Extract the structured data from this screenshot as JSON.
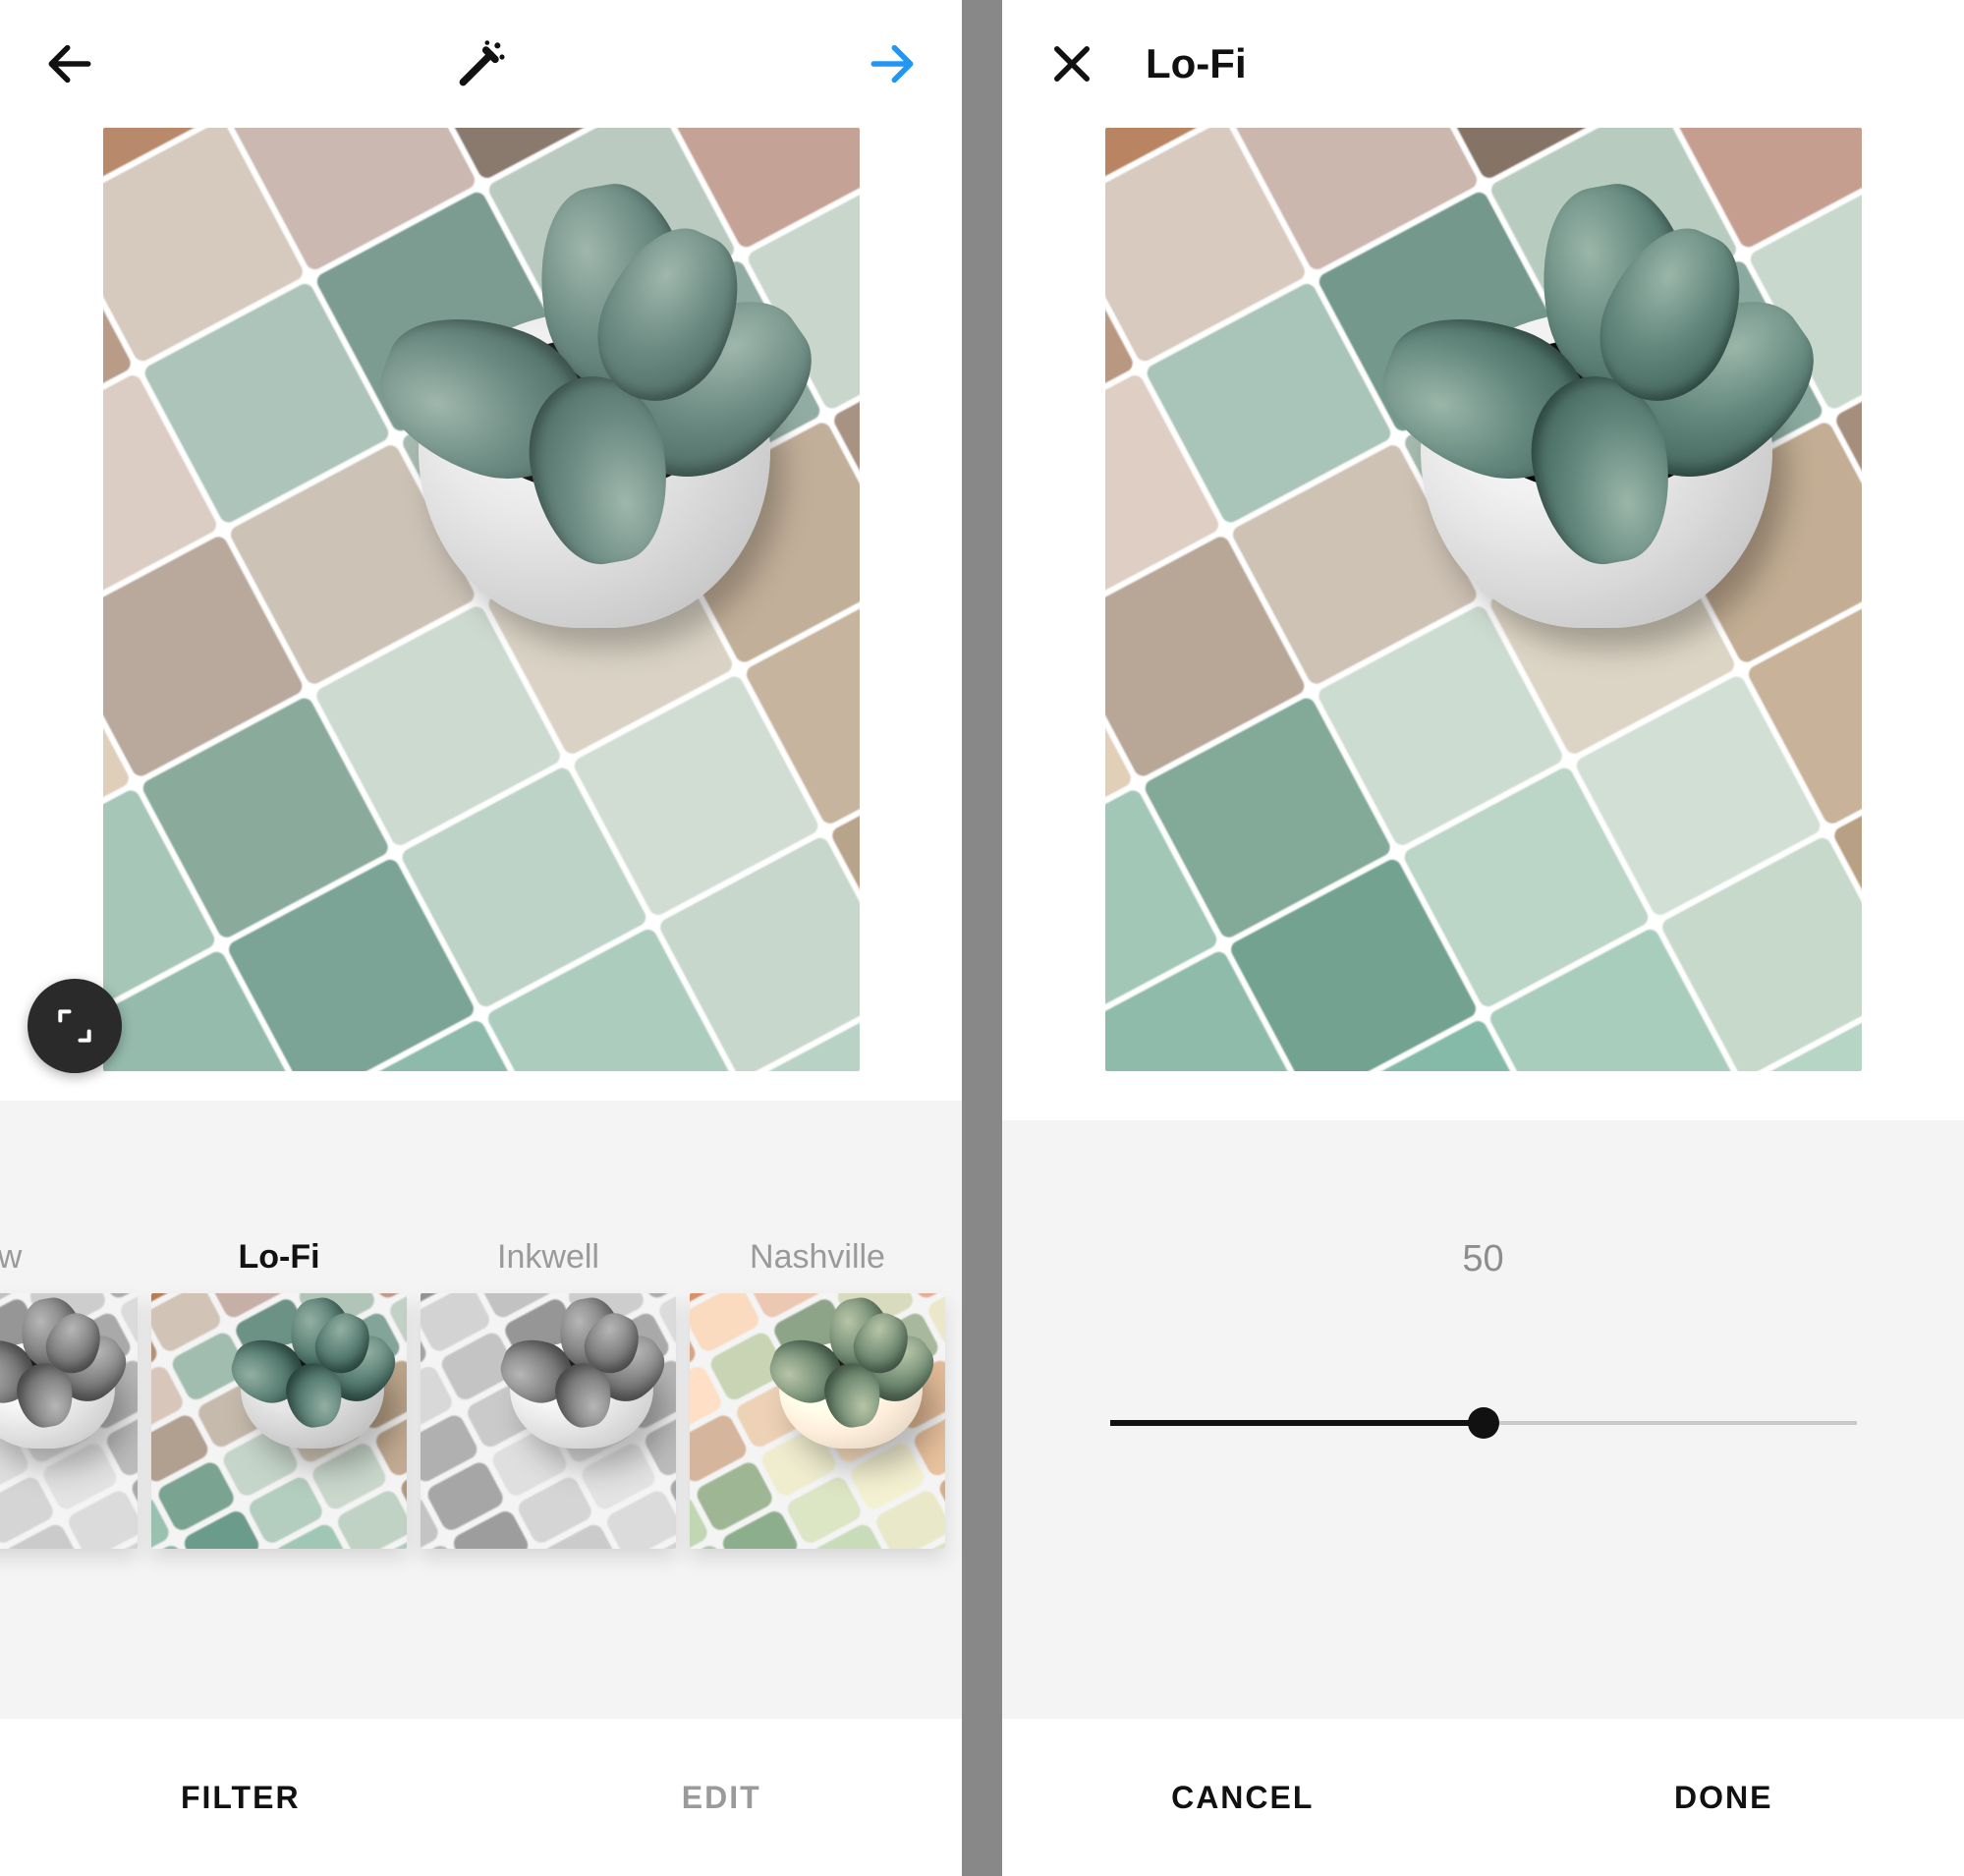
{
  "left": {
    "header": {
      "back_icon": "back-arrow-icon",
      "wand_icon": "magic-wand-icon",
      "next_icon": "next-arrow-icon",
      "next_color": "#2196f3"
    },
    "expand_icon": "expand-icon",
    "filters": [
      {
        "id": "willow",
        "label": "w",
        "style": "bw",
        "selected": false
      },
      {
        "id": "lofi",
        "label": "Lo-Fi",
        "style": "lofi",
        "selected": true
      },
      {
        "id": "inkwell",
        "label": "Inkwell",
        "style": "bw",
        "selected": false
      },
      {
        "id": "nashville",
        "label": "Nashville",
        "style": "nash",
        "selected": false
      }
    ],
    "tabs": {
      "filter": "FILTER",
      "edit": "EDIT",
      "active": "filter"
    }
  },
  "right": {
    "header": {
      "close_icon": "close-icon",
      "title": "Lo-Fi"
    },
    "slider": {
      "value": 50,
      "min": 0,
      "max": 100
    },
    "actions": {
      "cancel": "CANCEL",
      "done": "DONE"
    }
  },
  "palette": {
    "tile_colors": [
      "#d8c7a2",
      "#e0a94e",
      "#b7896a",
      "#c9b9a8",
      "#6e8e87",
      "#a3b7b0",
      "#c6b8c0",
      "#b79a86",
      "#d2c6bb",
      "#c8b5ae",
      "#8a7a6e",
      "#9da8a0",
      "#c7a9a1",
      "#d8c9c0",
      "#a9c1b6",
      "#7b9a90",
      "#b7c7bd",
      "#c2a093",
      "#dbcab6",
      "#b6a79a",
      "#c9bfb3",
      "#a5b8ad",
      "#8faaa0",
      "#c5d2c8",
      "#a3c3b5",
      "#88a99a",
      "#c9d6cc",
      "#d6cfc1",
      "#c0ad97",
      "#a79282",
      "#93b9ab",
      "#7aa395",
      "#b9cfc3",
      "#cdd9cf",
      "#c4b19b",
      "#b09b86",
      "#6e9f90",
      "#8bb8a9",
      "#a9c9bb",
      "#c3d3c7",
      "#b6a189",
      "#9f8a74",
      "#5a8e7f",
      "#79a997",
      "#97c0b0",
      "#b4cfc1",
      "#a38e76",
      "#8c7963"
    ]
  }
}
